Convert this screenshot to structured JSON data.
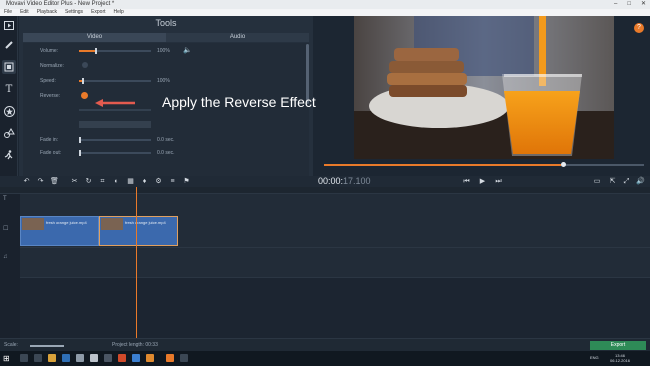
{
  "window": {
    "title": "Movavi Video Editor Plus - New Project *",
    "controls": [
      "–",
      "□",
      "✕"
    ]
  },
  "menu": {
    "items": [
      "File",
      "Edit",
      "Playback",
      "Settings",
      "Export",
      "Help"
    ]
  },
  "tools_panel": {
    "title": "Tools",
    "tabs": [
      {
        "label": "Video",
        "active": true
      },
      {
        "label": "Audio",
        "active": false
      }
    ],
    "properties": {
      "volume": {
        "label": "Volume:",
        "value": "100%",
        "level": 0.22
      },
      "normalize": {
        "label": "Normalize:"
      },
      "speed": {
        "label": "Speed:",
        "value": "100%",
        "level": 0.04
      },
      "reverse": {
        "label": "Reverse:",
        "on": true
      },
      "fade_in": {
        "label": "Fade in:",
        "value": "0.0 sec."
      },
      "fade_out": {
        "label": "Fade out:",
        "value": "0.0 sec."
      }
    }
  },
  "annotation": {
    "text": "Apply the Reverse Effect"
  },
  "preview": {
    "help_label": "?",
    "progress": 0.74
  },
  "timeline": {
    "timecode_main": "00:00:",
    "timecode_rest": "17.100",
    "clips": [
      {
        "name": "fresh orange juice.mp4"
      },
      {
        "name": "fresh orange juice.mp4"
      }
    ]
  },
  "bottom": {
    "scale_label": "Scale:",
    "project_length_label": "Project length:",
    "project_length_value": "00:33",
    "export_label": "Export"
  },
  "taskbar": {
    "time": "13:46",
    "date": "06.12.2016",
    "lang": "ENG"
  },
  "colors": {
    "accent": "#e97a2a",
    "export": "#2e8b57",
    "clip": "#3b69ad"
  }
}
